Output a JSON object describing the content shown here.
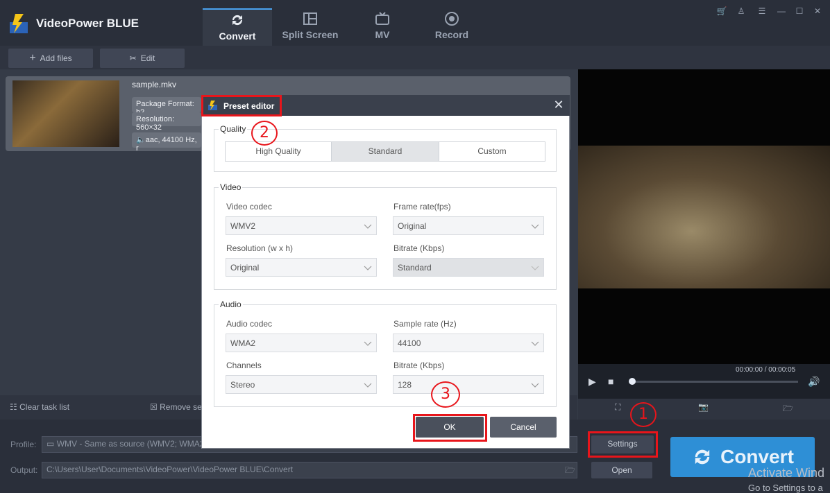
{
  "app": {
    "name": "VideoPower BLUE",
    "tabs": [
      "Convert",
      "Split Screen",
      "MV",
      "Record"
    ],
    "active_tab": "Convert"
  },
  "toolbar": {
    "add_files": "Add files",
    "edit": "Edit"
  },
  "file": {
    "name": "sample.mkv",
    "package_format": "Package Format: h2",
    "resolution": "Resolution: 560×32",
    "audio": "aac, 44100 Hz, r"
  },
  "player": {
    "time": "00:00:00 / 00:00:05"
  },
  "taskbar": {
    "clear": "Clear task list",
    "remove": "Remove se"
  },
  "bottom": {
    "profile_label": "Profile:",
    "profile_value": "WMV - Same as source (WMV2; WMA2",
    "output_label": "Output:",
    "output_value": "C:\\Users\\User\\Documents\\VideoPower\\VideoPower BLUE\\Convert",
    "settings": "Settings",
    "open": "Open",
    "convert": "Convert"
  },
  "watermark": {
    "line1": "Activate Wind",
    "line2": "Go to Settings to a"
  },
  "dialog": {
    "title": "Preset editor",
    "quality": {
      "title": "Quality",
      "options": [
        "High Quality",
        "Standard",
        "Custom"
      ],
      "selected": "Standard"
    },
    "video": {
      "title": "Video",
      "codec_label": "Video codec",
      "codec_value": "WMV2",
      "framerate_label": "Frame rate(fps)",
      "framerate_value": "Original",
      "resolution_label": "Resolution (w x h)",
      "resolution_value": "Original",
      "bitrate_label": "Bitrate (Kbps)",
      "bitrate_value": "Standard"
    },
    "audio": {
      "title": "Audio",
      "codec_label": "Audio codec",
      "codec_value": "WMA2",
      "samplerate_label": "Sample rate (Hz)",
      "samplerate_value": "44100",
      "channels_label": "Channels",
      "channels_value": "Stereo",
      "bitrate_label": "Bitrate (Kbps)",
      "bitrate_value": "128"
    },
    "ok": "OK",
    "cancel": "Cancel"
  },
  "annotations": [
    "1",
    "2",
    "3"
  ],
  "colors": {
    "accent": "#2e8fd6",
    "annotation": "#e8151b"
  }
}
